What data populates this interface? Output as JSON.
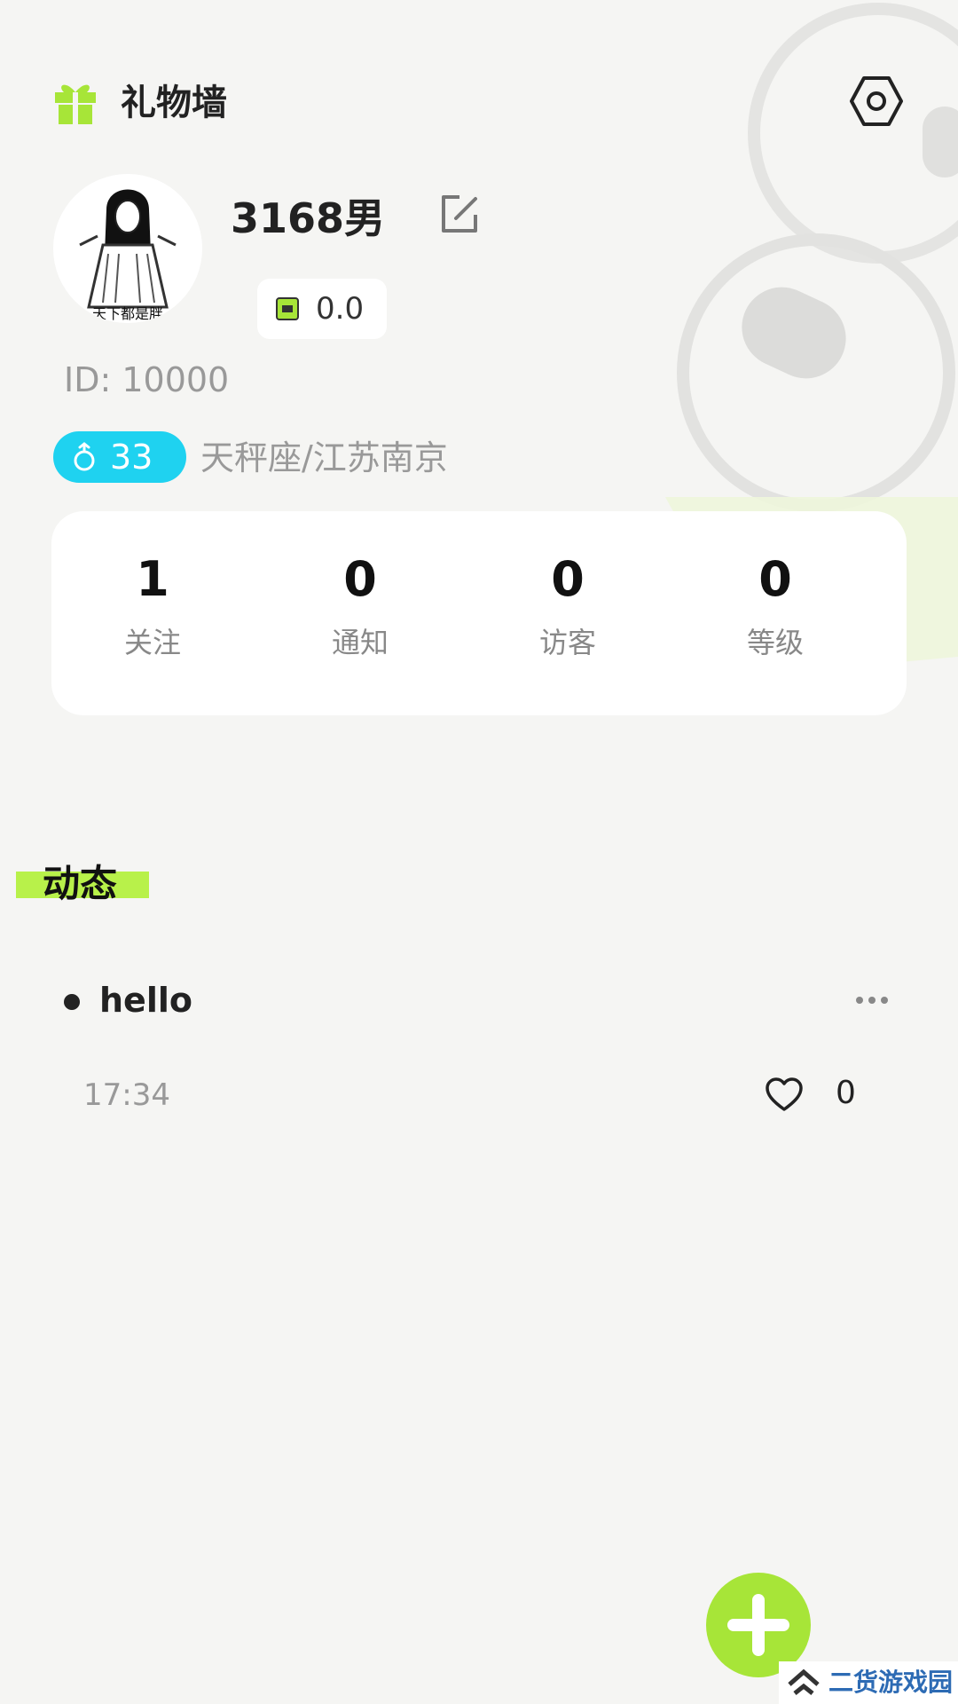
{
  "header": {
    "gift_wall_label": "礼物墙",
    "gift_icon": "gift-icon",
    "settings_icon": "settings-hex-icon"
  },
  "profile": {
    "avatar_caption": "天下都是胖",
    "username": "3168男",
    "edit_icon": "edit-icon",
    "balance": "0.0",
    "balance_icon": "wallet-icon",
    "id_text": "ID: 10000",
    "age": "33",
    "gender_icon": "male-icon",
    "location": "天秤座/江苏南京"
  },
  "stats": [
    {
      "value": "1",
      "label": "关注"
    },
    {
      "value": "0",
      "label": "通知"
    },
    {
      "value": "0",
      "label": "访客"
    },
    {
      "value": "0",
      "label": "等级"
    }
  ],
  "feed": {
    "section_title": "动态",
    "posts": [
      {
        "text": "hello",
        "time": "17:34",
        "likes": "0"
      }
    ]
  },
  "watermark": {
    "text": "二货游戏园"
  },
  "colors": {
    "accent_green": "#a7e538",
    "highlight_green": "#b8f14a",
    "age_badge_cyan": "#1fd2f0",
    "background": "#f5f5f3"
  }
}
